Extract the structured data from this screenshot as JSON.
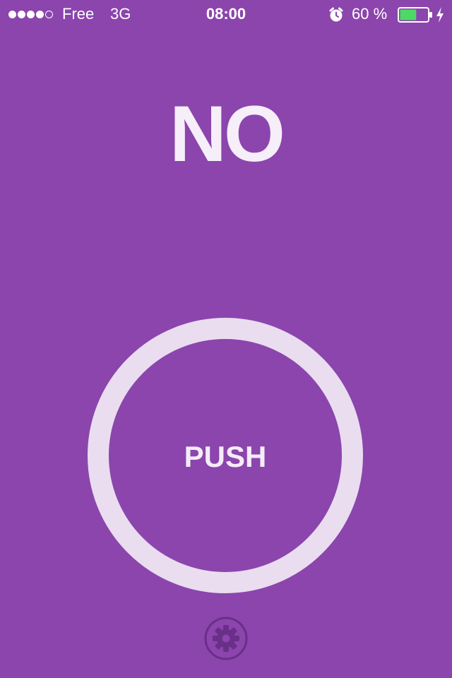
{
  "status_bar": {
    "signal_bars_filled": 4,
    "signal_bars_total": 5,
    "carrier": "Free",
    "network": "3G",
    "time": "08:00",
    "alarm_icon": "alarm-clock-icon",
    "battery_percent": "60 %",
    "battery_level": 0.6,
    "battery_color": "#4cd964",
    "charging_icon": "lightning-bolt-icon"
  },
  "main": {
    "answer": "NO",
    "push_label": "PUSH",
    "settings_icon": "gear-icon"
  },
  "colors": {
    "background": "#8b45ad",
    "ring": "#e9ddef",
    "settings_icon": "#6a2f88"
  }
}
